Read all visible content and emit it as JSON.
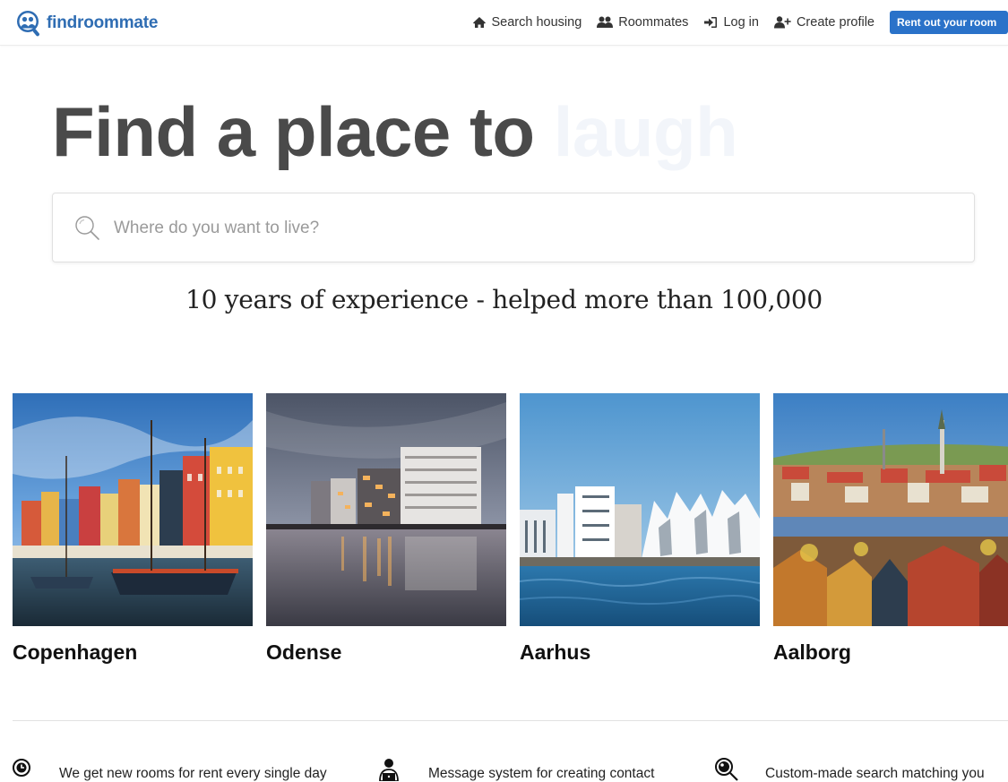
{
  "brand": {
    "name": "findroommate",
    "color": "#2f6db3"
  },
  "nav": {
    "search_housing": "Search housing",
    "roommates": "Roommates",
    "login": "Log in",
    "create_profile": "Create profile",
    "rent_out": "Rent out your room"
  },
  "hero": {
    "title_prefix": "Find a place to",
    "title_word": "laugh"
  },
  "search": {
    "placeholder": "Where do you want to live?"
  },
  "tagline": "10 years of experience - helped more than 100,000",
  "cities": [
    {
      "name": "Copenhagen"
    },
    {
      "name": "Odense"
    },
    {
      "name": "Aarhus"
    },
    {
      "name": "Aalborg"
    }
  ],
  "features": [
    {
      "icon": "clock-icon",
      "text": "We get new rooms for rent every single day"
    },
    {
      "icon": "person-laptop-icon",
      "text": "Message system for creating contact"
    },
    {
      "icon": "magnifier-icon",
      "text": "Custom-made search matching you"
    }
  ],
  "colors": {
    "accent": "#2a72c9",
    "heading": "#4a4a4a"
  }
}
